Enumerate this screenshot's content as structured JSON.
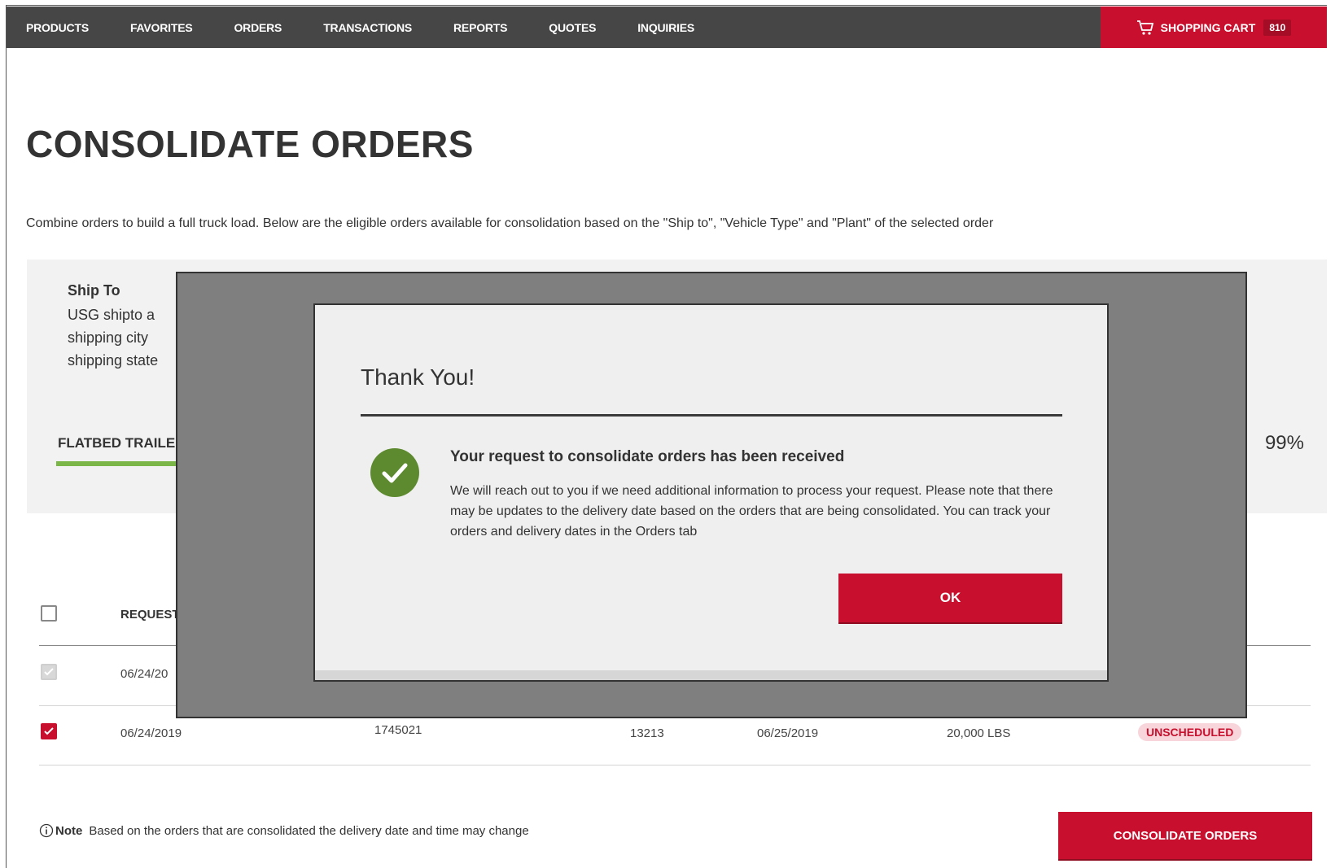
{
  "nav": {
    "items": [
      "PRODUCTS",
      "FAVORITES",
      "ORDERS",
      "TRANSACTIONS",
      "REPORTS",
      "QUOTES",
      "INQUIRIES"
    ],
    "cart_label": "SHOPPING CART",
    "cart_count": "810"
  },
  "page": {
    "title": "CONSOLIDATE ORDERS",
    "description": "Combine orders to build a full truck load. Below are the eligible orders available for consolidation based on the \"Ship to\", \"Vehicle Type\" and \"Plant\" of the selected order"
  },
  "ship_to": {
    "label": "Ship To",
    "line1": "USG shipto a",
    "line2": "shipping city",
    "line3": "shipping state"
  },
  "trailer": {
    "label": "FLATBED TRAILE",
    "fill_percent": "99%"
  },
  "table": {
    "header_request": "REQUEST",
    "rows": [
      {
        "date": "06/24/20",
        "checked": true,
        "disabled": true
      },
      {
        "date": "06/24/2019",
        "order": "1745021",
        "id": "13213",
        "delivery": "06/25/2019",
        "weight": "20,000 LBS",
        "status": "UNSCHEDULED",
        "checked": true
      }
    ]
  },
  "note": {
    "label": "Note",
    "text": "Based on the orders that are consolidated the delivery date and time may change"
  },
  "consolidate_button": "CONSOLIDATE ORDERS",
  "modal": {
    "title": "Thank You!",
    "heading": "Your request to consolidate orders has been received",
    "body": "We will reach out to you if we need additional information to process your request. Please note that there may be updates to the delivery date based on the orders that are being consolidated. You can track your orders and delivery dates in the Orders tab",
    "ok_label": "OK"
  },
  "colors": {
    "brand_red": "#c8102e",
    "nav_bg": "#464646",
    "success_green": "#5d8a2e",
    "progress_green": "#7ab648"
  }
}
